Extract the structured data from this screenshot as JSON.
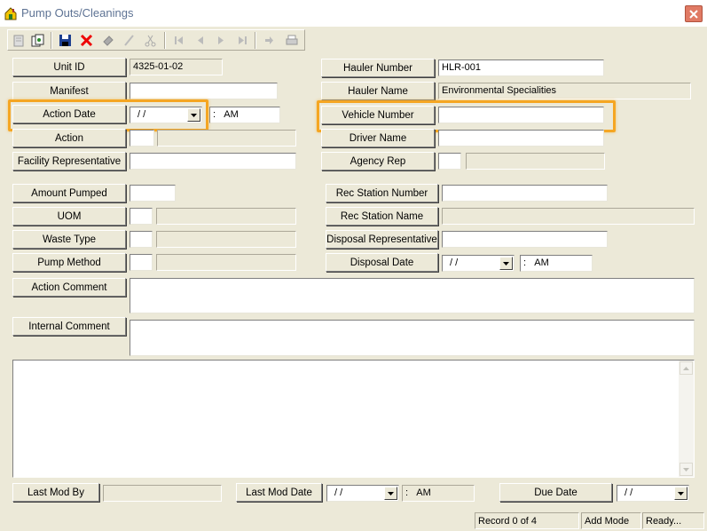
{
  "window": {
    "title": "Pump Outs/Cleanings"
  },
  "toolbar": {
    "buttons": [
      "notepad-icon",
      "copy-icon",
      "save-icon",
      "delete-icon",
      "erase-icon",
      "edit-icon",
      "cut-icon",
      "first-record-icon",
      "prev-record-icon",
      "next-record-icon",
      "last-record-icon",
      "goto-icon",
      "print-icon"
    ]
  },
  "form": {
    "unit_id": {
      "label": "Unit ID",
      "value": "4325-01-02"
    },
    "manifest": {
      "label": "Manifest",
      "value": ""
    },
    "action_date": {
      "label": "Action Date",
      "date": "/ /",
      "time_sep": ":",
      "ampm": "AM"
    },
    "action": {
      "label": "Action",
      "value": ""
    },
    "facility_rep": {
      "label": "Facility Representative",
      "value": ""
    },
    "hauler_number": {
      "label": "Hauler Number",
      "value": "HLR-001"
    },
    "hauler_name": {
      "label": "Hauler Name",
      "value": "Environmental Specialities"
    },
    "vehicle_number": {
      "label": "Vehicle Number",
      "value": ""
    },
    "driver_name": {
      "label": "Driver Name",
      "value": ""
    },
    "agency_rep": {
      "label": "Agency Rep",
      "value": ""
    },
    "amount_pumped": {
      "label": "Amount Pumped",
      "value": ""
    },
    "uom": {
      "label": "UOM",
      "value": ""
    },
    "waste_type": {
      "label": "Waste Type",
      "value": ""
    },
    "pump_method": {
      "label": "Pump Method",
      "value": ""
    },
    "rec_station_number": {
      "label": "Rec Station Number",
      "value": ""
    },
    "rec_station_name": {
      "label": "Rec Station Name",
      "value": ""
    },
    "disposal_rep": {
      "label": "Disposal Representative",
      "value": ""
    },
    "disposal_date": {
      "label": "Disposal Date",
      "date": "/ /",
      "time_sep": ":",
      "ampm": "AM"
    },
    "action_comment": {
      "label": "Action Comment",
      "value": ""
    },
    "internal_comment": {
      "label": "Internal Comment",
      "value": ""
    }
  },
  "footer": {
    "last_mod_by": {
      "label": "Last Mod By",
      "value": ""
    },
    "last_mod_date": {
      "label": "Last Mod Date",
      "date": "/ /",
      "time_sep": ":",
      "ampm": "AM"
    },
    "due_date": {
      "label": "Due Date",
      "date": "/ /"
    }
  },
  "statusbar": {
    "record": "Record 0 of 4",
    "mode": "Add Mode",
    "state": "Ready..."
  },
  "colors": {
    "highlight": "#f5a623",
    "close": "#e07a64",
    "background": "#ece9d8"
  }
}
